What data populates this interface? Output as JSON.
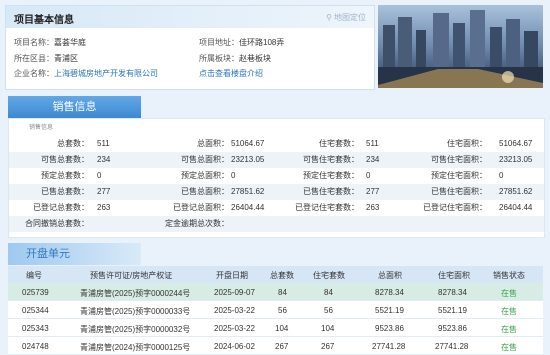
{
  "project": {
    "title": "项目基本信息",
    "map_link": "地图定位",
    "name_label": "项目名称：",
    "name_value": "嘉荟华庭",
    "address_label": "项目地址：",
    "address_value": "佳环路108弄",
    "district_label": "所在区县：",
    "district_value": "青浦区",
    "sector_label": "所属板块：",
    "sector_value": "赵巷板块",
    "company_label": "企业名称：",
    "company_value": "上海碧城房地产开发有限公司",
    "intro_link": "点击查看楼盘介绍"
  },
  "sales": {
    "title": "销售信息",
    "subtitle": "销售信息",
    "rows": [
      {
        "c1l": "总套数：",
        "c1v": "511",
        "c2l": "总面积：",
        "c2v": "51064.67",
        "c3l": "住宅套数：",
        "c3v": "511",
        "c4l": "住宅面积：",
        "c4v": "51064.67"
      },
      {
        "c1l": "可售总套数：",
        "c1v": "234",
        "c2l": "可售总面积：",
        "c2v": "23213.05",
        "c3l": "可售住宅套数：",
        "c3v": "234",
        "c4l": "可售住宅面积：",
        "c4v": "23213.05"
      },
      {
        "c1l": "预定总套数：",
        "c1v": "0",
        "c2l": "预定总面积：",
        "c2v": "0",
        "c3l": "预定住宅套数：",
        "c3v": "0",
        "c4l": "预定住宅面积：",
        "c4v": "0"
      },
      {
        "c1l": "已售总套数：",
        "c1v": "277",
        "c2l": "已售总面积：",
        "c2v": "27851.62",
        "c3l": "已售住宅套数：",
        "c3v": "277",
        "c4l": "已售住宅面积：",
        "c4v": "27851.62"
      },
      {
        "c1l": "已登记总套数：",
        "c1v": "263",
        "c2l": "已登记总面积：",
        "c2v": "26404.44",
        "c3l": "已登记住宅套数：",
        "c3v": "263",
        "c4l": "已登记住宅面积：",
        "c4v": "26404.44"
      },
      {
        "c1l": "合同撤销总套数：",
        "c1v": "",
        "c2l": "定金逾期总次数：",
        "c2v": "",
        "c3l": "",
        "c3v": "",
        "c4l": "",
        "c4v": ""
      }
    ]
  },
  "units": {
    "title": "开盘单元",
    "headers": [
      "编号",
      "预售许可证/房地产权证",
      "开盘日期",
      "总套数",
      "住宅套数",
      "总面积",
      "住宅面积",
      "销售状态"
    ],
    "rows": [
      [
        "025739",
        "青浦房管(2025)预字0000244号",
        "2025-09-07",
        "84",
        "84",
        "8278.34",
        "8278.34",
        "在售"
      ],
      [
        "025344",
        "青浦房管(2025)预字0000033号",
        "2025-03-22",
        "56",
        "56",
        "5521.19",
        "5521.19",
        "在售"
      ],
      [
        "025343",
        "青浦房管(2025)预字0000032号",
        "2025-03-22",
        "104",
        "104",
        "9523.86",
        "9523.86",
        "在售"
      ],
      [
        "024748",
        "青浦房管(2024)预字0000125号",
        "2024-06-02",
        "267",
        "267",
        "27741.28",
        "27741.28",
        "在售"
      ]
    ]
  },
  "colors": {
    "accent": "#3c89d2",
    "status": "#3aa34a",
    "link": "#2b74c2"
  }
}
